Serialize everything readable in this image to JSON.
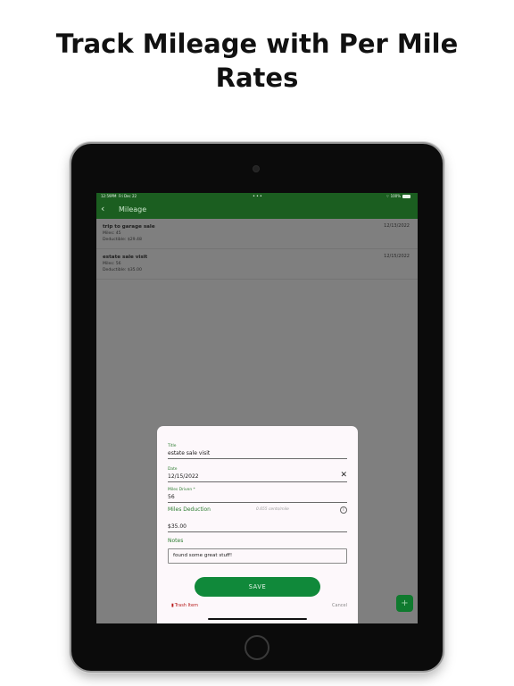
{
  "headline": {
    "line1": "Track Mileage with Per Mile",
    "line2": "Rates"
  },
  "statusbar": {
    "time": "12:59PM",
    "date": "Fri Dec 22",
    "dots": "•••",
    "wifi": "⌔",
    "battery": "100%"
  },
  "navbar": {
    "back": "‹",
    "title": "Mileage"
  },
  "trips": [
    {
      "title": "trip to garage sale",
      "miles": "Miles: 45",
      "deductible": "Deductible: $29.48",
      "date": "12/13/2022"
    },
    {
      "title": "estate sale visit",
      "miles": "Miles: 56",
      "deductible": "Deductible: $35.00",
      "date": "12/15/2022"
    }
  ],
  "form": {
    "title_label": "Title",
    "title_value": "estate sale visit",
    "date_label": "Date",
    "date_value": "12/15/2022",
    "clear_icon": "✕",
    "miles_label": "Miles Driven *",
    "miles_value": "56",
    "deduction_label": "Miles Deduction",
    "rate_hint": "0.655 cents/mile",
    "info_icon": "i",
    "deduction_value": "$35.00",
    "notes_label": "Notes",
    "notes_value": "found some great stuff!",
    "save_label": "SAVE",
    "trash_icon": "▮",
    "trash_label": "Trash Item",
    "cancel_label": "Cancel"
  },
  "fab": {
    "icon": "+"
  },
  "colors": {
    "nav_green": "#1b5e20",
    "accent_green": "#10893a",
    "label_green": "#2e7d32",
    "trash_red": "#b71c1c"
  }
}
